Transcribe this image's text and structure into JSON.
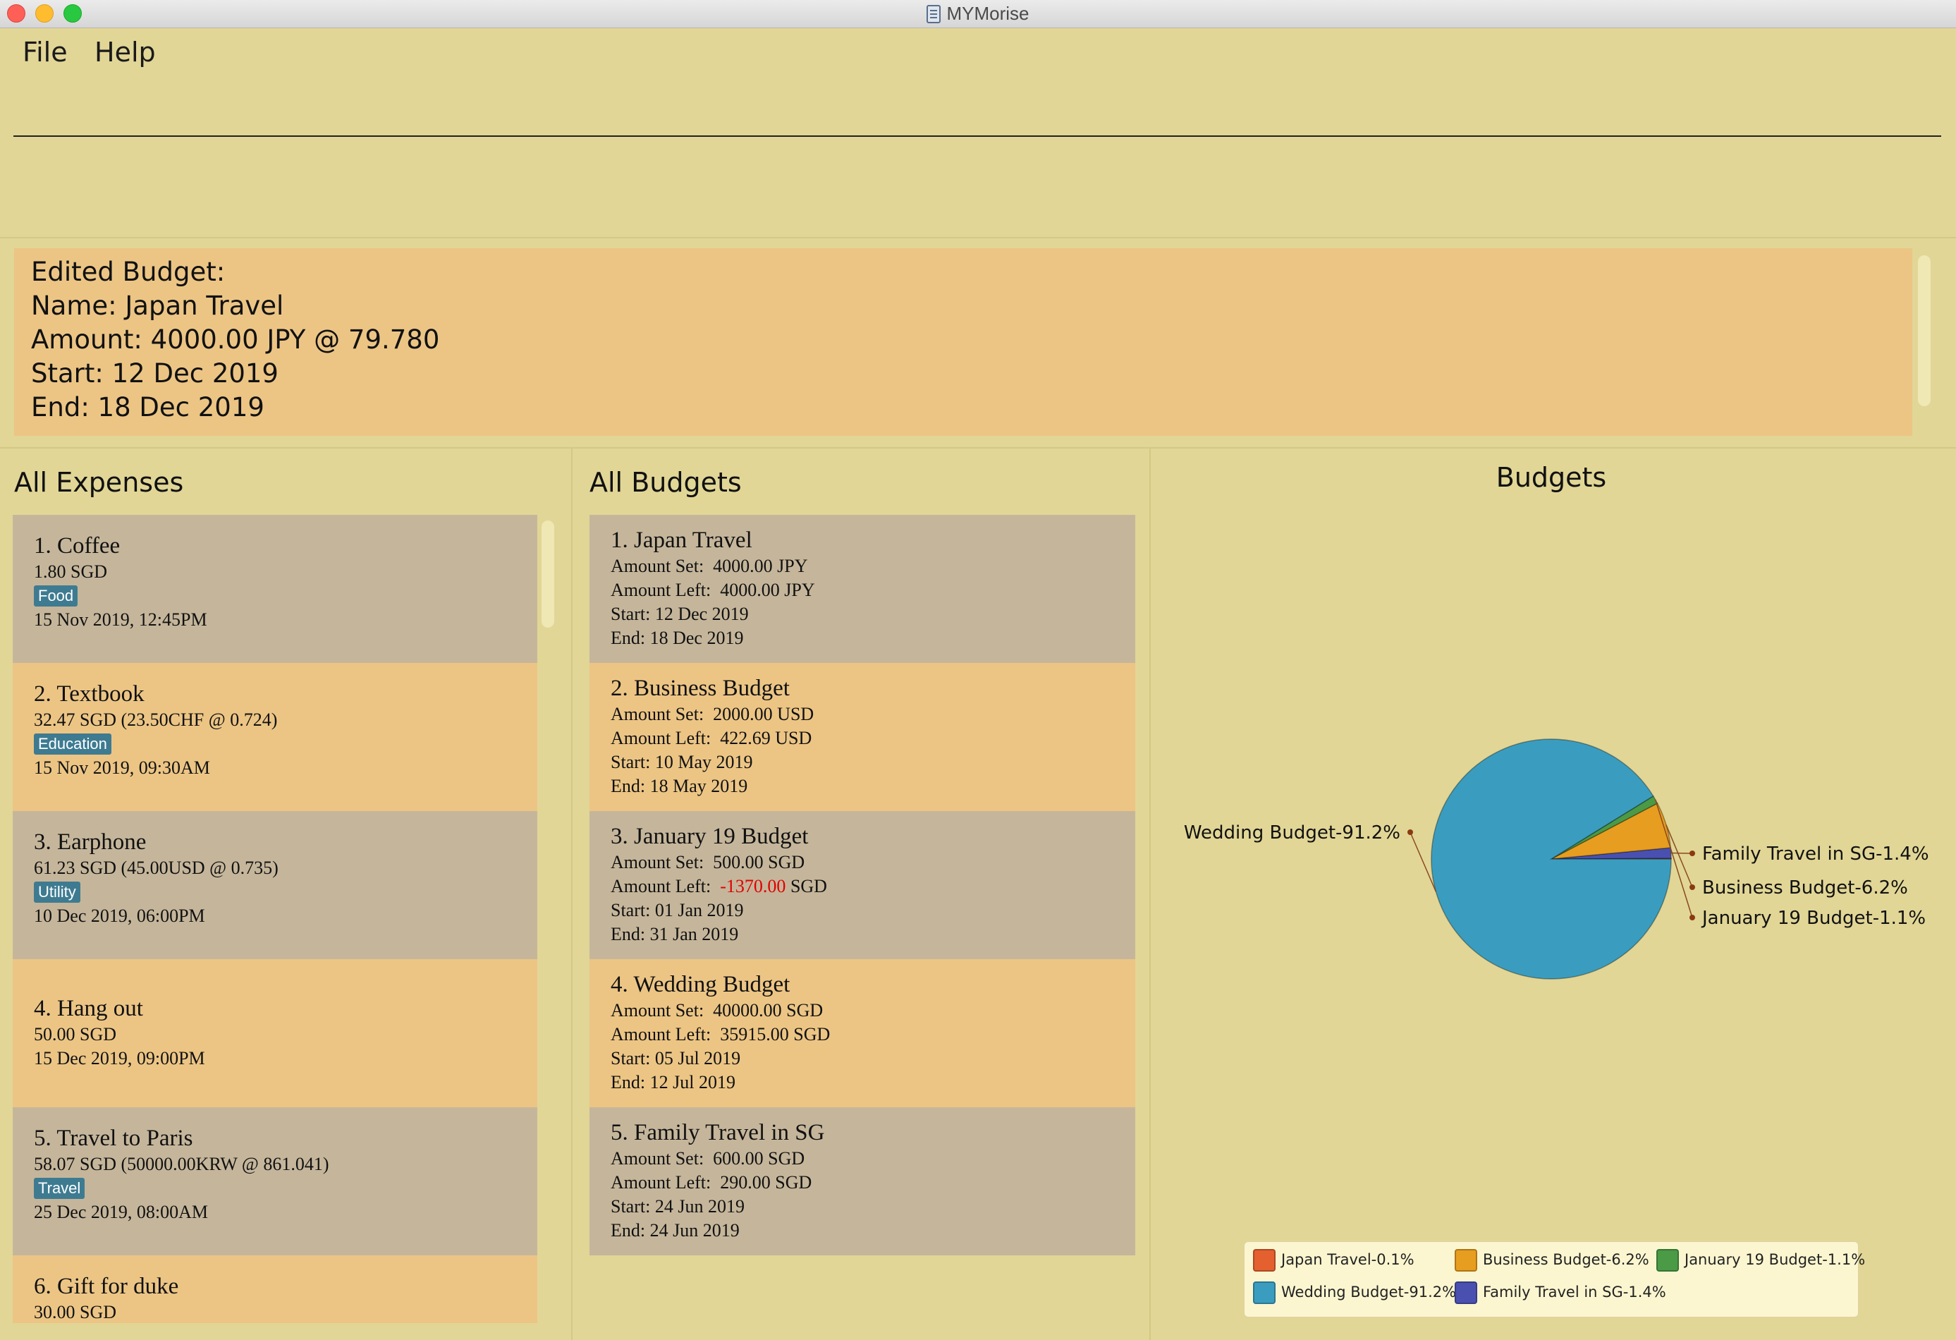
{
  "window": {
    "title": "MYMorise"
  },
  "menu": {
    "file": "File",
    "help": "Help"
  },
  "command": {
    "value": "",
    "placeholder": ""
  },
  "result": {
    "lines": [
      "Edited Budget:",
      "Name: Japan Travel",
      "Amount: 4000.00 JPY @ 79.780",
      "Start: 12 Dec 2019",
      "End: 18 Dec 2019"
    ]
  },
  "expenses": {
    "title": "All Expenses",
    "items": [
      {
        "name": "1.  Coffee",
        "amount": "1.80 SGD",
        "tag": "Food",
        "date": "15 Nov 2019, 12:45PM"
      },
      {
        "name": "2.  Textbook",
        "amount": "32.47 SGD  (23.50CHF @ 0.724)",
        "tag": "Education",
        "date": "15 Nov 2019, 09:30AM"
      },
      {
        "name": "3.  Earphone",
        "amount": "61.23 SGD  (45.00USD @ 0.735)",
        "tag": "Utility",
        "date": "10 Dec 2019, 06:00PM"
      },
      {
        "name": "4.  Hang out",
        "amount": "50.00 SGD",
        "tag": "",
        "date": "15 Dec 2019, 09:00PM"
      },
      {
        "name": "5.  Travel to Paris",
        "amount": "58.07 SGD  (50000.00KRW @ 861.041)",
        "tag": "Travel",
        "date": "25 Dec 2019, 08:00AM"
      },
      {
        "name": "6.  Gift for duke",
        "amount": "30.00 SGD",
        "tag": "",
        "date": ""
      }
    ]
  },
  "budgets": {
    "title": "All Budgets",
    "items": [
      {
        "name": "1.  Japan Travel",
        "set_label": "Amount Set:",
        "set": "4000.00 JPY",
        "left_label": "Amount Left:",
        "left": "4000.00",
        "left_cur": "JPY",
        "left_negative": false,
        "start": "Start:  12 Dec 2019",
        "end": "End:  18 Dec 2019"
      },
      {
        "name": "2.  Business Budget",
        "set_label": "Amount Set:",
        "set": "2000.00 USD",
        "left_label": "Amount Left:",
        "left": "422.69",
        "left_cur": "USD",
        "left_negative": false,
        "start": "Start:  10 May 2019",
        "end": "End:  18 May 2019"
      },
      {
        "name": "3.  January 19 Budget",
        "set_label": "Amount Set:",
        "set": "500.00 SGD",
        "left_label": "Amount Left:",
        "left": "-1370.00",
        "left_cur": "SGD",
        "left_negative": true,
        "start": "Start:  01 Jan 2019",
        "end": "End:  31 Jan 2019"
      },
      {
        "name": "4.  Wedding Budget",
        "set_label": "Amount Set:",
        "set": "40000.00 SGD",
        "left_label": "Amount Left:",
        "left": "35915.00",
        "left_cur": "SGD",
        "left_negative": false,
        "start": "Start:  05 Jul 2019",
        "end": "End:  12 Jul 2019"
      },
      {
        "name": "5.  Family Travel in SG",
        "set_label": "Amount Set:",
        "set": "600.00 SGD",
        "left_label": "Amount Left:",
        "left": "290.00",
        "left_cur": "SGD",
        "left_negative": false,
        "start": "Start:  24 Jun 2019",
        "end": "End:  24 Jun 2019"
      }
    ]
  },
  "chart_data": {
    "type": "pie",
    "title": "Budgets",
    "slices": [
      {
        "label": "Japan Travel-0.1%",
        "value": 0.1,
        "color": "#e4602f"
      },
      {
        "label": "Business Budget-6.2%",
        "value": 6.2,
        "color": "#e79d1f"
      },
      {
        "label": "January 19 Budget-1.1%",
        "value": 1.1,
        "color": "#4a9a46"
      },
      {
        "label": "Wedding Budget-91.2%",
        "value": 91.2,
        "color": "#3a9dbf"
      },
      {
        "label": "Family Travel in SG-1.4%",
        "value": 1.4,
        "color": "#4a50b0"
      }
    ],
    "legend_position": "bottom"
  }
}
